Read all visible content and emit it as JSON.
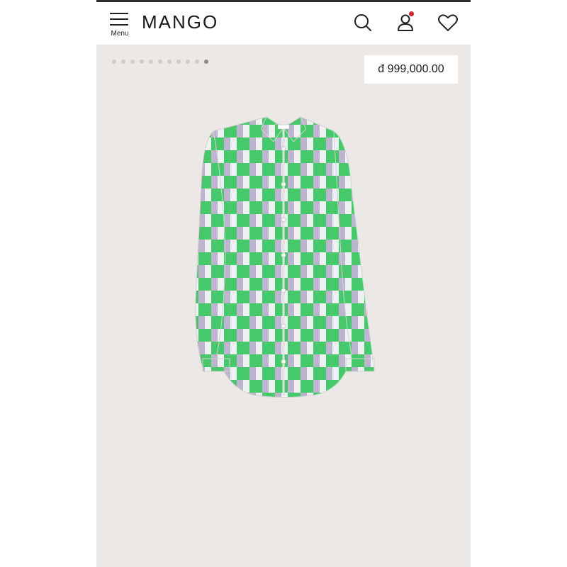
{
  "header": {
    "menu_label": "Menu",
    "brand": "MANGO",
    "icons": [
      "search-icon",
      "user-icon",
      "heart-icon"
    ],
    "notification_dot_color": "#d2202f"
  },
  "gallery": {
    "total_images": 11,
    "active_index": 11
  },
  "product": {
    "price": "đ 999,000.00",
    "image": "green and lilac checkered long-sleeve shirt"
  },
  "colors": {
    "background": "#ece8e5",
    "shirt_green": "#46c96a",
    "shirt_lilac": "#bdb5cf",
    "shirt_white": "#eef2ef"
  }
}
